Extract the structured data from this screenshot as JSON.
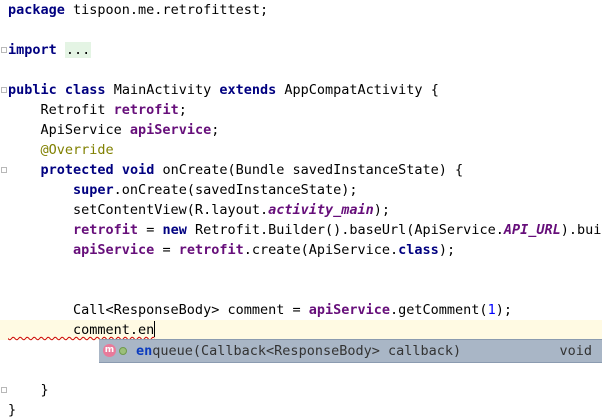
{
  "editor": {
    "code": {
      "package_kw": "package",
      "package_name": " tispoon.me.retrofittest;",
      "import_kw": "import",
      "import_folded": "...",
      "public_kw": "public",
      "class_kw": "class",
      "class_name": " MainActivity ",
      "extends_kw": "extends",
      "class_tail": " AppCompatActivity {",
      "retrofit_type": "    Retrofit ",
      "retrofit_field": "retrofit",
      "semicolon": ";",
      "apiservice_type": "    ApiService ",
      "apiservice_field": "apiService",
      "annotation": "    @Override",
      "protected_kw": "protected",
      "void_kw": "void",
      "oncreate_sig": " onCreate(Bundle savedInstanceState) {",
      "super_kw": "super",
      "super_call": ".onCreate(savedInstanceState);",
      "setcontent_prefix": "        setContentView(R.layout.",
      "activity_main": "activity_main",
      "setcontent_suffix": ");",
      "retrofit_assign": " = ",
      "new_kw": "new",
      "builder_prefix": " Retrofit.Builder().baseUrl(ApiService.",
      "api_url": "API_URL",
      "builder_suffix": ").build",
      "apiservice_assign": " = ",
      "create_prefix": ".create(ApiService.",
      "class_literal": "class",
      "create_suffix": ");",
      "call_prefix": "        Call<ResponseBody> comment = ",
      "getcomment_prefix": ".getComment(",
      "getcomment_arg": "1",
      "getcomment_suffix": ");",
      "typing": "        comment.en",
      "close_method": "    }",
      "close_class": "}"
    },
    "completion": {
      "icon": "method-icon",
      "visibility_icon": "public-visibility-icon",
      "icon_letter": "m",
      "match": "en",
      "rest": "queue(Callback<ResponseBody> callback)",
      "return_type": "void"
    }
  }
}
